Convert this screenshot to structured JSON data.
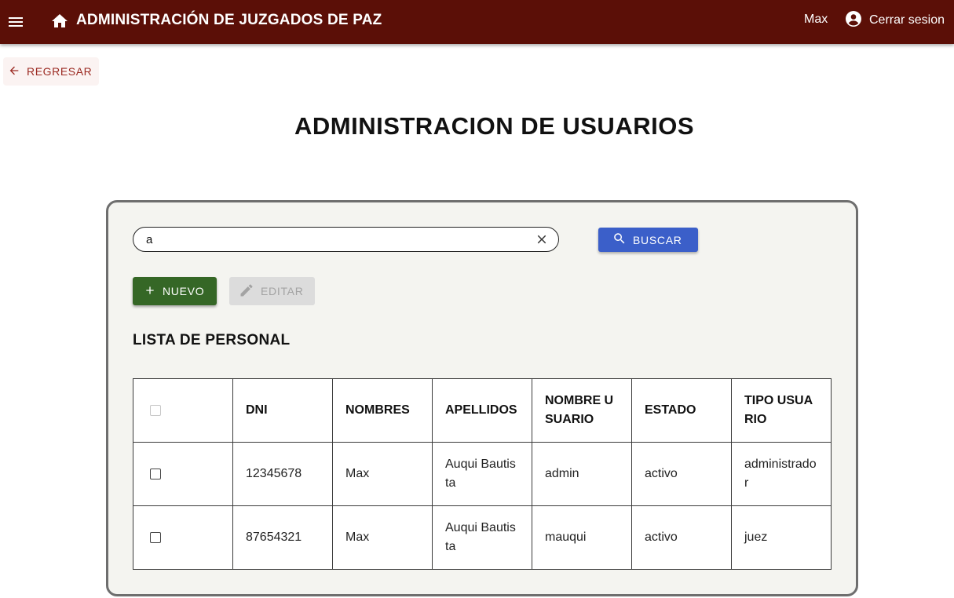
{
  "header": {
    "title": "ADMINISTRACIÓN DE JUZGADOS DE PAZ",
    "user_name": "Max",
    "logout_label": "Cerrar sesion"
  },
  "back_button": {
    "label": "REGRESAR"
  },
  "page_title": "ADMINISTRACION DE USUARIOS",
  "search": {
    "value": "a",
    "button_label": "BUSCAR"
  },
  "actions": {
    "new_label": "NUEVO",
    "edit_label": "EDITAR"
  },
  "section_title": "LISTA DE PERSONAL",
  "table": {
    "columns": [
      "DNI",
      "NOMBRES",
      "APELLIDOS",
      "NOMBRE USUARIO",
      "ESTADO",
      "TIPO USUARIO"
    ],
    "rows": [
      {
        "dni": "12345678",
        "nombres": "Max",
        "apellidos": "Auqui Bautista",
        "usuario": "admin",
        "estado": "activo",
        "tipo": "administrador"
      },
      {
        "dni": "87654321",
        "nombres": "Max",
        "apellidos": "Auqui Bautista",
        "usuario": "mauqui",
        "estado": "activo",
        "tipo": "juez"
      }
    ]
  },
  "colors": {
    "appbar": "#5b0f07",
    "search_button": "#3b5fc9",
    "new_button": "#356726",
    "back_text": "#9b2a22"
  },
  "icons": [
    "menu-icon",
    "home-icon",
    "account-circle-icon",
    "arrow-left-icon",
    "close-icon",
    "search-icon",
    "plus-icon",
    "pencil-icon"
  ]
}
